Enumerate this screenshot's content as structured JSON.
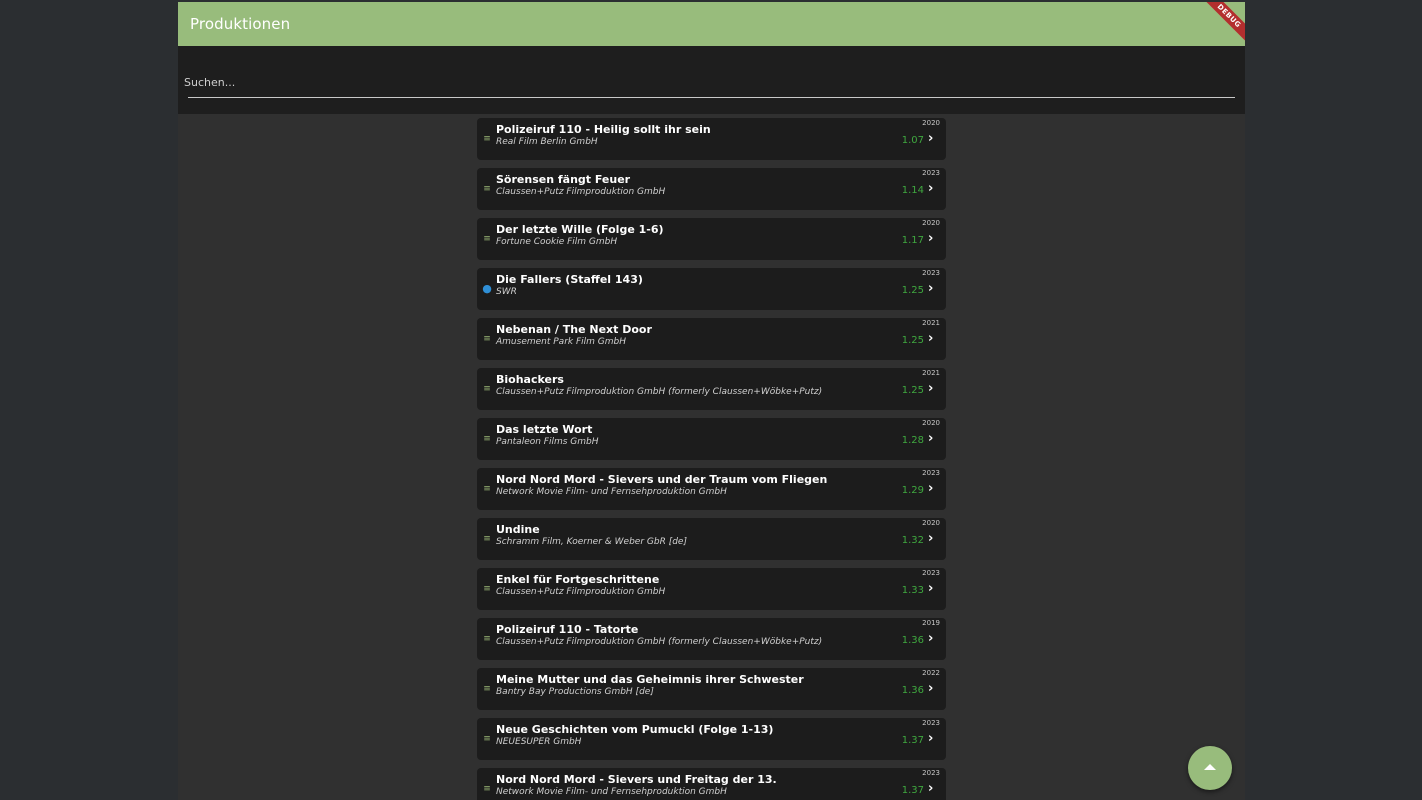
{
  "appbar": {
    "title": "Produktionen",
    "debug_label": "DEBUG"
  },
  "search": {
    "placeholder": "Suchen..."
  },
  "productions": [
    {
      "title": "Polizeiruf 110 - Heilig sollt ihr sein",
      "company": "Real Film Berlin GmbH",
      "year": "2020",
      "score": "1.07",
      "icon": "playlist-check-icon"
    },
    {
      "title": "Sörensen fängt Feuer",
      "company": "Claussen+Putz Filmproduktion GmbH",
      "year": "2023",
      "score": "1.14",
      "icon": "playlist-check-icon"
    },
    {
      "title": "Der letzte Wille (Folge 1-6)",
      "company": "Fortune Cookie Film GmbH",
      "year": "2020",
      "score": "1.17",
      "icon": "playlist-check-icon"
    },
    {
      "title": "Die Fallers (Staffel 143)",
      "company": "SWR",
      "year": "2023",
      "score": "1.25",
      "icon": "chat-bubble-icon"
    },
    {
      "title": "Nebenan / The Next Door",
      "company": "Amusement Park Film GmbH",
      "year": "2021",
      "score": "1.25",
      "icon": "playlist-check-icon"
    },
    {
      "title": "Biohackers",
      "company": "Claussen+Putz Filmproduktion GmbH (formerly Claussen+Wöbke+Putz)",
      "year": "2021",
      "score": "1.25",
      "icon": "playlist-check-icon"
    },
    {
      "title": "Das letzte Wort",
      "company": "Pantaleon Films GmbH",
      "year": "2020",
      "score": "1.28",
      "icon": "playlist-check-icon"
    },
    {
      "title": "Nord Nord Mord - Sievers und der Traum vom Fliegen",
      "company": "Network Movie Film- und Fernsehproduktion GmbH",
      "year": "2023",
      "score": "1.29",
      "icon": "playlist-check-icon"
    },
    {
      "title": "Undine",
      "company": "Schramm Film, Koerner & Weber GbR [de]",
      "year": "2020",
      "score": "1.32",
      "icon": "playlist-check-icon"
    },
    {
      "title": "Enkel für Fortgeschrittene",
      "company": "Claussen+Putz Filmproduktion GmbH",
      "year": "2023",
      "score": "1.33",
      "icon": "playlist-check-icon"
    },
    {
      "title": "Polizeiruf 110 - Tatorte",
      "company": "Claussen+Putz Filmproduktion GmbH (formerly Claussen+Wöbke+Putz)",
      "year": "2019",
      "score": "1.36",
      "icon": "playlist-check-icon"
    },
    {
      "title": "Meine Mutter und das Geheimnis ihrer Schwester",
      "company": "Bantry Bay Productions GmbH [de]",
      "year": "2022",
      "score": "1.36",
      "icon": "playlist-check-icon"
    },
    {
      "title": "Neue Geschichten vom Pumuckl (Folge 1-13)",
      "company": "NEUESUPER GmbH",
      "year": "2023",
      "score": "1.37",
      "icon": "playlist-check-icon"
    },
    {
      "title": "Nord Nord Mord - Sievers und Freitag der 13.",
      "company": "Network Movie Film- und Fernsehproduktion GmbH",
      "year": "2023",
      "score": "1.37",
      "icon": "playlist-check-icon"
    }
  ],
  "fab": {
    "icon": "arrow-up-icon"
  },
  "colors": {
    "accent": "#98bc7c",
    "score": "#3fa83f",
    "debug": "#b32e2e"
  }
}
